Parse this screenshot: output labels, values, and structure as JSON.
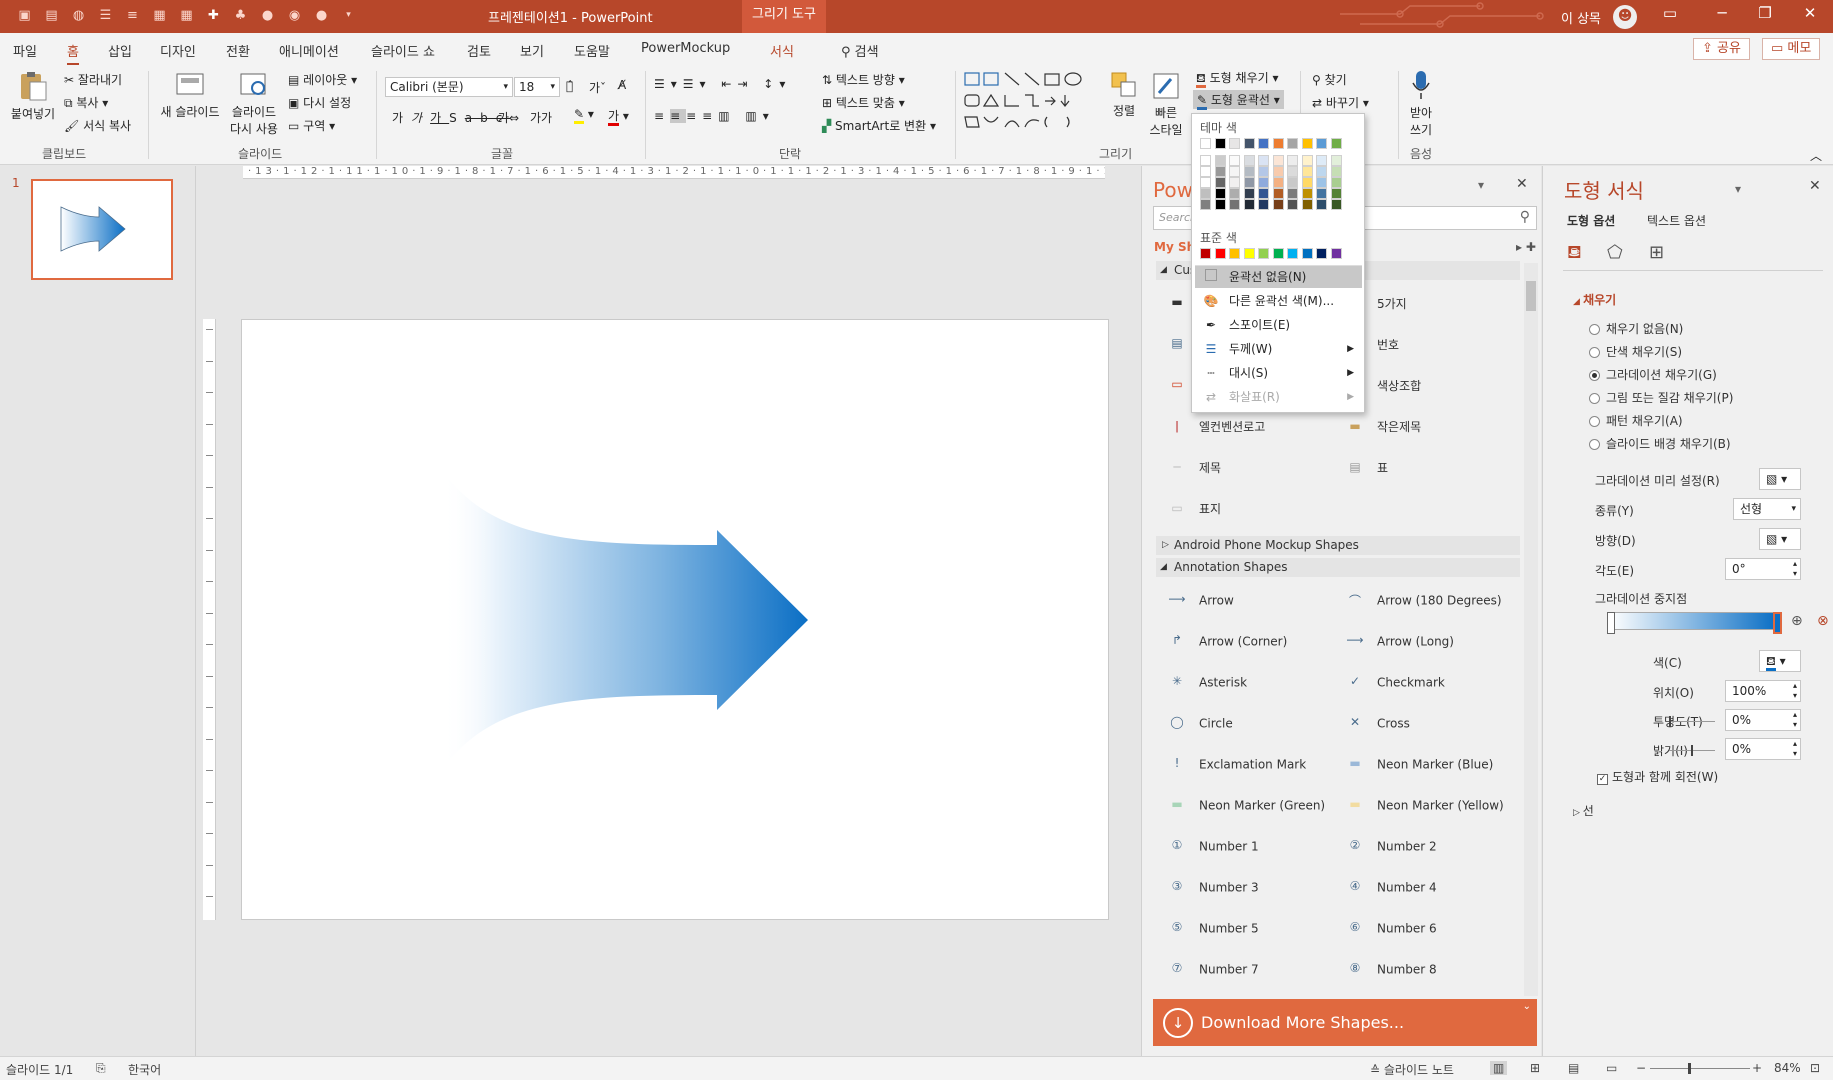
{
  "titlebar": {
    "document": "프레젠테이션1  -  PowerPoint",
    "context_tab": "그리기 도구",
    "user": "이 상목",
    "qat_icons": [
      "undo-icon",
      "redo-icon",
      "start-icon",
      "bullets-icon",
      "list-icon",
      "table-icon",
      "grid-icon",
      "plus-icon",
      "shape-icon",
      "circle-icon",
      "oval-icon",
      "more-icon"
    ]
  },
  "tabs": [
    "파일",
    "홈",
    "삽입",
    "디자인",
    "전환",
    "애니메이션",
    "슬라이드 쇼",
    "검토",
    "보기",
    "도움말",
    "PowerMockup",
    "서식"
  ],
  "tab_search": "검색",
  "share": "공유",
  "memo": "메모",
  "ribbon": {
    "paste": "붙여넣기",
    "cut": "잘라내기",
    "copy": "복사",
    "format_copy": "서식 복사",
    "clipboard": "클립보드",
    "new_slide": "새 슬라이드",
    "reuse_slide_1": "슬라이드",
    "reuse_slide_2": "다시 사용",
    "layout": "레이아웃",
    "reset": "다시 설정",
    "section": "구역",
    "slides_group": "슬라이드",
    "font_name": "Calibri (본문)",
    "font_size": "18",
    "font_group": "글꼴",
    "paragraph_group": "단락",
    "text_direction": "텍스트 방향",
    "text_align": "텍스트 맞춤",
    "smartart": "SmartArt로 변환",
    "arrange": "정렬",
    "quick_style_1": "빠른",
    "quick_style_2": "스타일",
    "shape_fill": "도형 채우기",
    "shape_outline": "도형 윤곽선",
    "drawing_group": "그리기",
    "find": "찾기",
    "replace": "바꾸기",
    "dictate_1": "받아",
    "dictate_2": "쓰기",
    "voice_group": "음성"
  },
  "thumbnail_number": "1",
  "outline_dropdown": {
    "theme_colors": "테마 색",
    "standard_colors": "표준 색",
    "theme_row": [
      "#ffffff",
      "#000000",
      "#e7e6e6",
      "#44546a",
      "#4472c4",
      "#ed7d31",
      "#a5a5a5",
      "#ffc000",
      "#5b9bd5",
      "#70ad47"
    ],
    "standard_row": [
      "#c00000",
      "#ff0000",
      "#ffc000",
      "#ffff00",
      "#92d050",
      "#00b050",
      "#00b0f0",
      "#0070c0",
      "#002060",
      "#7030a0"
    ],
    "items": [
      {
        "label": "윤곽선 없음(N)",
        "icon": "no-outline-icon"
      },
      {
        "label": "다른 윤곽선 색(M)...",
        "icon": "palette-icon"
      },
      {
        "label": "스포이트(E)",
        "icon": "eyedropper-icon"
      },
      {
        "label": "두께(W)",
        "icon": "weight-icon"
      },
      {
        "label": "대시(S)",
        "icon": "dash-icon"
      },
      {
        "label": "화살표(R)",
        "icon": "arrow-style-icon"
      }
    ]
  },
  "powermockup": {
    "title": "Pow",
    "search_placeholder": "Search",
    "my_shapes": "My Sha",
    "custom_section": "Cus",
    "custom_items": [
      "5가지",
      "번호",
      "색상조합",
      "엘컨벤션로고",
      "작은제목",
      "제목",
      "표",
      "표지"
    ],
    "android_section": "Android Phone Mockup Shapes",
    "annotation_section": "Annotation Shapes",
    "annotation_items": [
      "Arrow",
      "Arrow (180 Degrees)",
      "Arrow (Corner)",
      "Arrow (Long)",
      "Asterisk",
      "Checkmark",
      "Circle",
      "Cross",
      "Exclamation Mark",
      "Neon Marker (Blue)",
      "Neon Marker (Green)",
      "Neon Marker (Yellow)",
      "Number 1",
      "Number 2",
      "Number 3",
      "Number 4",
      "Number 5",
      "Number 6",
      "Number 7",
      "Number 8"
    ],
    "download": "Download More Shapes..."
  },
  "format_pane": {
    "title": "도형 서식",
    "tab_shape": "도형 옵션",
    "tab_text": "텍스트 옵션",
    "fill_header": "채우기",
    "fill_options": [
      "채우기 없음(N)",
      "단색 채우기(S)",
      "그라데이션 채우기(G)",
      "그림 또는 질감 채우기(P)",
      "패턴 채우기(A)",
      "슬라이드 배경 채우기(B)"
    ],
    "fill_selected": 2,
    "preset_label": "그라데이션 미리 설정(R)",
    "type_label": "종류(Y)",
    "type_value": "선형",
    "direction_label": "방향(D)",
    "angle_label": "각도(E)",
    "angle_value": "0°",
    "stops_label": "그라데이션 중지점",
    "color_label": "색(C)",
    "position_label": "위치(O)",
    "position_value": "100%",
    "transparency_label": "투명도(T)",
    "transparency_value": "0%",
    "brightness_label": "밝기(I)",
    "brightness_value": "0%",
    "rotate_with_shape": "도형과 함께 회전(W)",
    "line_header": "선"
  },
  "statusbar": {
    "slide_count": "슬라이드 1/1",
    "language": "한국어",
    "notes": "슬라이드 노트",
    "zoom": "84%"
  },
  "colors": {
    "accent": "#b7472a",
    "download": "#e0693f",
    "arrow_gradient_start": "#ffffff",
    "arrow_gradient_end": "#0b6fc5"
  }
}
